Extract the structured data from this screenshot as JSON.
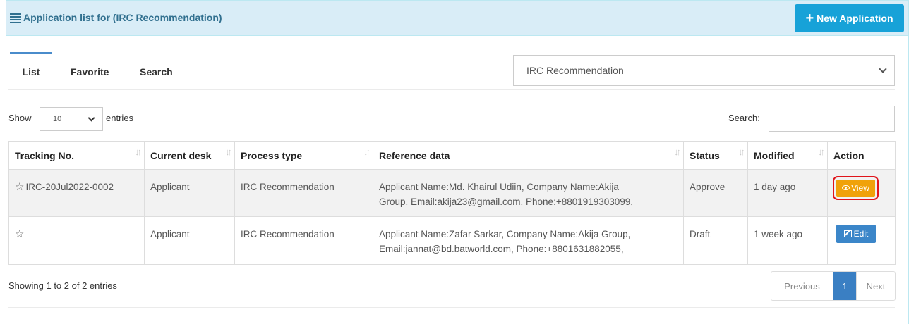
{
  "header": {
    "title": "Application list for (IRC Recommendation)",
    "new_button_label": "New Application"
  },
  "tabs": [
    {
      "label": "List",
      "active": true
    },
    {
      "label": "Favorite",
      "active": false
    },
    {
      "label": "Search",
      "active": false
    }
  ],
  "process_select": {
    "value": "IRC Recommendation"
  },
  "length_control": {
    "show_label": "Show",
    "value": "10",
    "entries_label": "entries"
  },
  "search_control": {
    "label": "Search:",
    "value": ""
  },
  "table": {
    "columns": [
      "Tracking No.",
      "Current desk",
      "Process type",
      "Reference data",
      "Status",
      "Modified",
      "Action"
    ],
    "rows": [
      {
        "tracking_no": "IRC-20Jul2022-0002",
        "current_desk": "Applicant",
        "process_type": "IRC Recommendation",
        "reference_line1": "Applicant Name:Md. Khairul Udiin, Company Name:Akija",
        "reference_line2": "Group, Email:akija23@gmail.com, Phone:+8801919303099,",
        "status": "Approve",
        "modified": "1 day ago",
        "action": "View"
      },
      {
        "tracking_no": "",
        "current_desk": "Applicant",
        "process_type": "IRC Recommendation",
        "reference_line1": "Applicant Name:Zafar Sarkar, Company Name:Akija Group,",
        "reference_line2": "Email:jannat@bd.batworld.com, Phone:+8801631882055,",
        "status": "Draft",
        "modified": "1 week ago",
        "action": "Edit"
      }
    ]
  },
  "footer": {
    "info": "Showing 1 to 2 of 2 entries",
    "pagination": {
      "previous": "Previous",
      "current": "1",
      "next": "Next"
    }
  },
  "colors": {
    "heading_bg": "#d9edf7",
    "heading_text": "#31708f",
    "new_button": "#17a2d8",
    "view_button": "#f0a20a",
    "edit_button": "#3b86c9",
    "highlight_outline": "#e0141b",
    "active_page": "#3a7fc3"
  },
  "icons": {
    "title": "list-icon",
    "new_button": "plus-icon",
    "favorite": "star-outline-icon",
    "sort": "sort-icon",
    "view": "eye-icon",
    "edit": "edit-icon"
  }
}
